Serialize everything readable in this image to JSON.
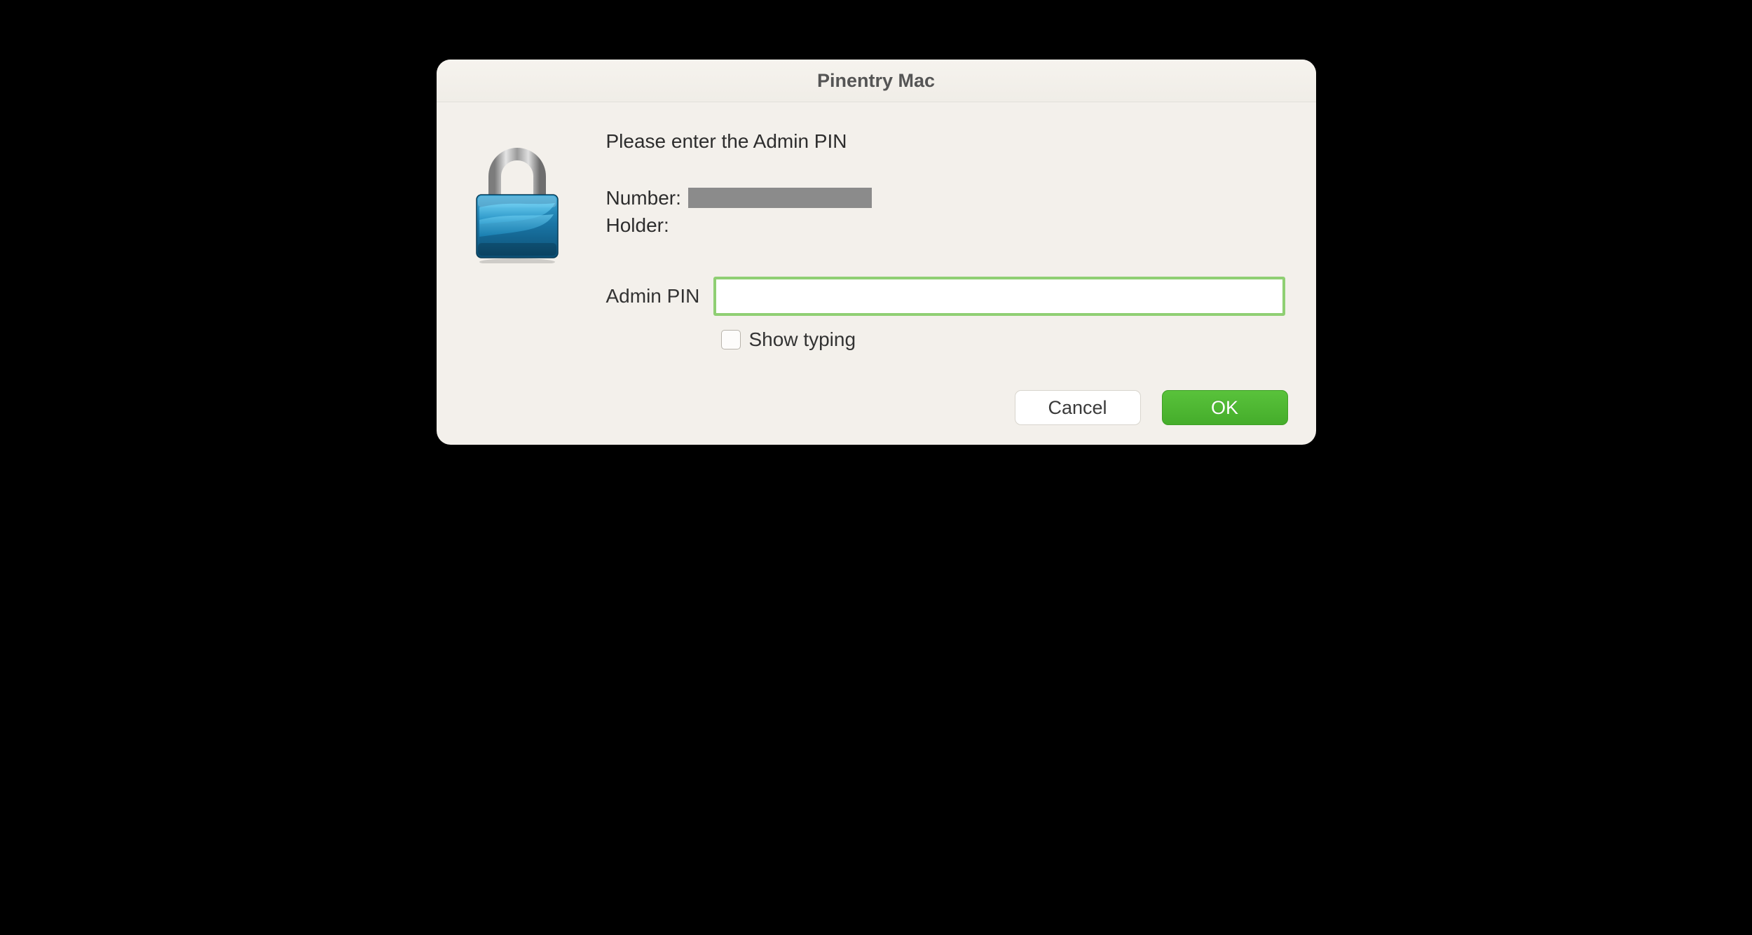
{
  "dialog": {
    "title": "Pinentry Mac",
    "prompt": "Please enter the Admin PIN",
    "number_label": "Number:",
    "number_value_redacted": true,
    "holder_label": "Holder:",
    "holder_value": "",
    "pin_label": "Admin PIN",
    "pin_value": "",
    "show_typing_label": "Show typing",
    "show_typing_checked": false,
    "cancel_label": "Cancel",
    "ok_label": "OK"
  }
}
